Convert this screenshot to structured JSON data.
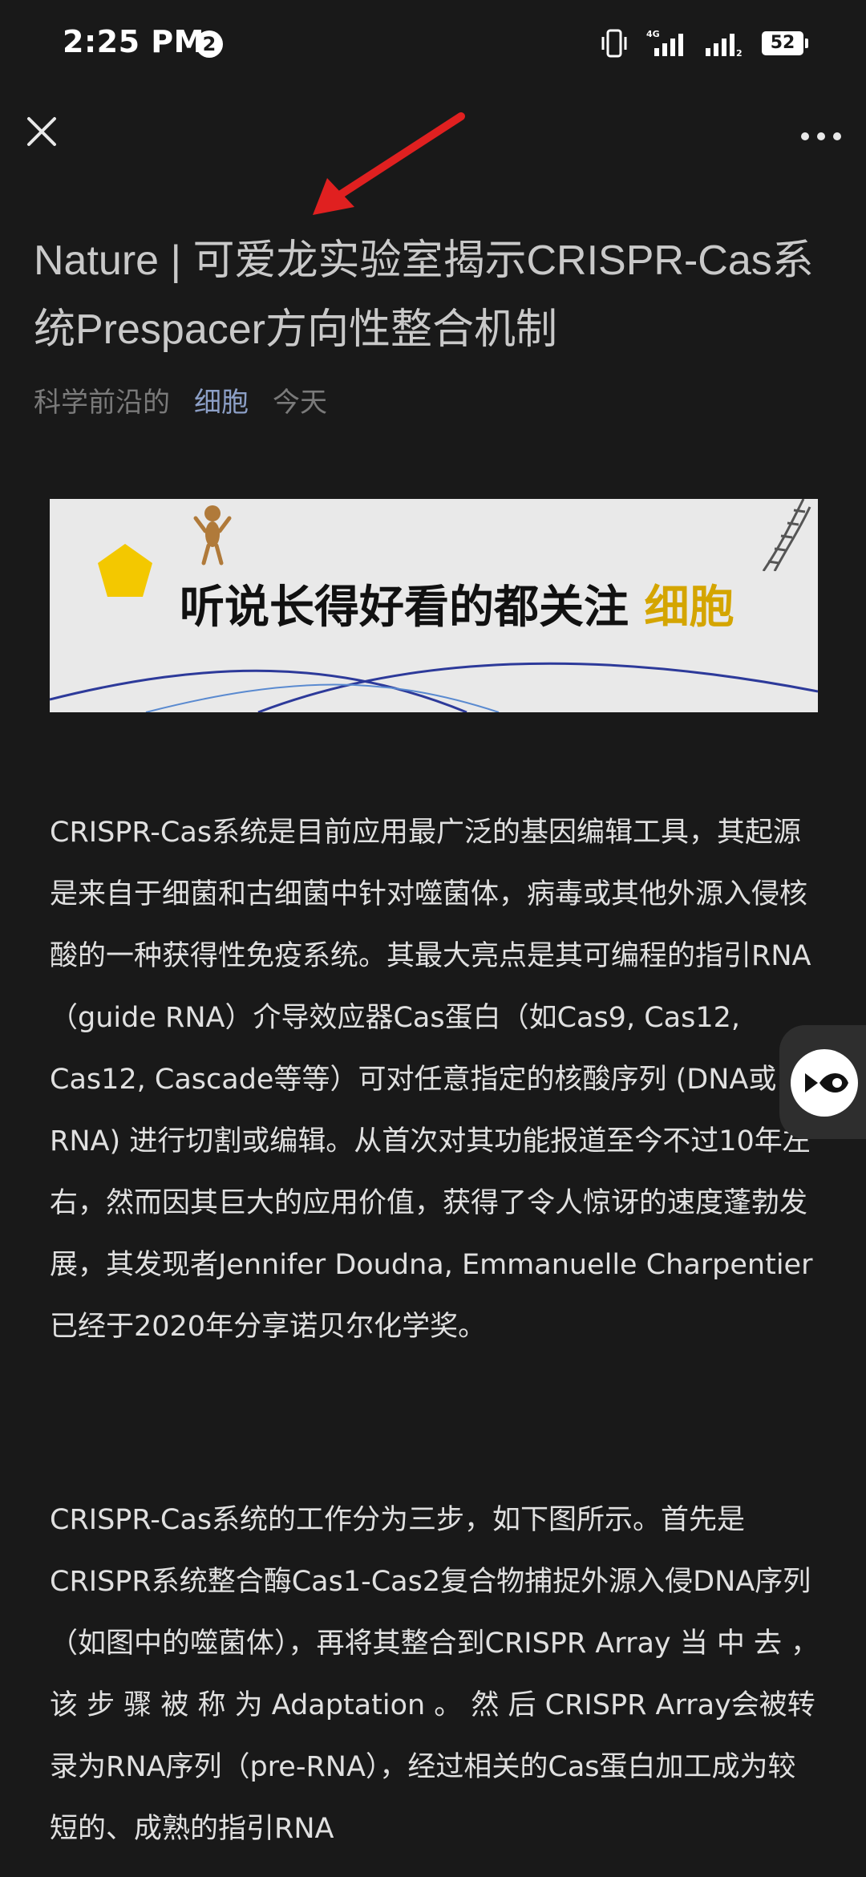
{
  "status": {
    "time": "2:25 PM",
    "notification_count": "2",
    "battery": "52",
    "network": "4G"
  },
  "nav": {
    "close_icon": "close-icon",
    "more_icon": "more-horizontal-icon"
  },
  "article": {
    "title": "Nature | 可爱龙实验室揭示CRISPR-Cas系统Prespacer方向性整合机制",
    "source": "科学前沿的",
    "account": "细胞",
    "date": "今天",
    "banner": {
      "text_main": "听说长得好看的都关注",
      "text_highlight": "细胞"
    },
    "paragraphs": [
      "CRISPR-Cas系统是目前应用最广泛的基因编辑工具，其起源是来自于细菌和古细菌中针对噬菌体，病毒或其他外源入侵核酸的一种获得性免疫系统。其最大亮点是其可编程的指引RNA（guide RNA）介导效应器Cas蛋白（如Cas9, Cas12, Cas12, Cascade等等）可对任意指定的核酸序列 (DNA或RNA) 进行切割或编辑。从首次对其功能报道至今不过10年左右，然而因其巨大的应用价值，获得了令人惊讶的速度蓬勃发展，其发现者Jennifer Doudna, Emmanuelle Charpentier已经于2020年分享诺贝尔化学奖。",
      "CRISPR-Cas系统的工作分为三步，如下图所示。首先是CRISPR系统整合酶Cas1-Cas2复合物捕捉外源入侵DNA序列（如图中的噬菌体），再将其整合到CRISPR Array 当 中 去 ， 该 步 骤 被 称 为 Adaptation 。 然 后 CRISPR Array会被转录为RNA序列（pre-RNA），经过相关的Cas蛋白加工成为较短的、成熟的指引RNA"
    ]
  },
  "colors": {
    "background": "#191919",
    "text": "#e0e0e0",
    "muted": "#7a7a7a",
    "link": "#8c9fc6",
    "annotation_arrow": "#e02020",
    "banner_highlight": "#d4a500"
  }
}
